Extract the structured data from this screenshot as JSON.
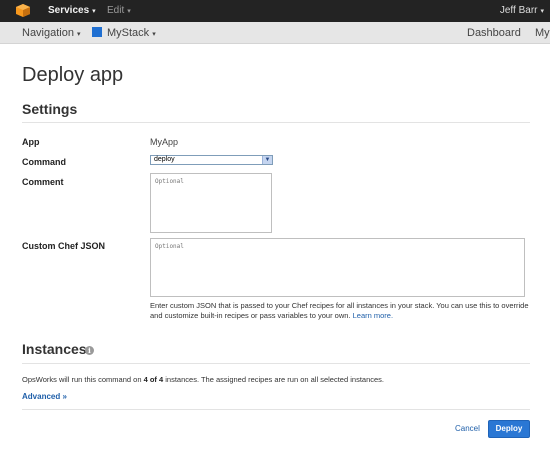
{
  "topbar": {
    "services_label": "Services",
    "edit_label": "Edit",
    "user_label": "Jeff Barr",
    "caret": "▾",
    "logo_color": "#f7981d"
  },
  "navbar": {
    "navigation_label": "Navigation",
    "stack_label": "MyStack",
    "dashboard_label": "Dashboard",
    "my_label": "My",
    "caret": "▾",
    "stack_color": "#1f6fd1"
  },
  "page": {
    "title": "Deploy app"
  },
  "settings": {
    "heading": "Settings",
    "app_label": "App",
    "app_value": "MyApp",
    "command_label": "Command",
    "command_value": "deploy",
    "comment_label": "Comment",
    "comment_placeholder": "Optional",
    "json_label": "Custom Chef JSON",
    "json_placeholder": "Optional",
    "help_text": "Enter custom JSON that is passed to your Chef recipes for all instances in your stack. You can use this to override and customize built-in recipes or pass variables to your own.",
    "help_link": "Learn more."
  },
  "instances": {
    "heading": "Instances",
    "info_icon": "i",
    "text_before": "OpsWorks will run this command on ",
    "count_text": "4 of 4",
    "text_after": " instances. The assigned recipes are run on all selected instances.",
    "advanced_label": "Advanced »"
  },
  "actions": {
    "cancel_label": "Cancel",
    "deploy_label": "Deploy",
    "accent_color": "#2a77d4"
  }
}
